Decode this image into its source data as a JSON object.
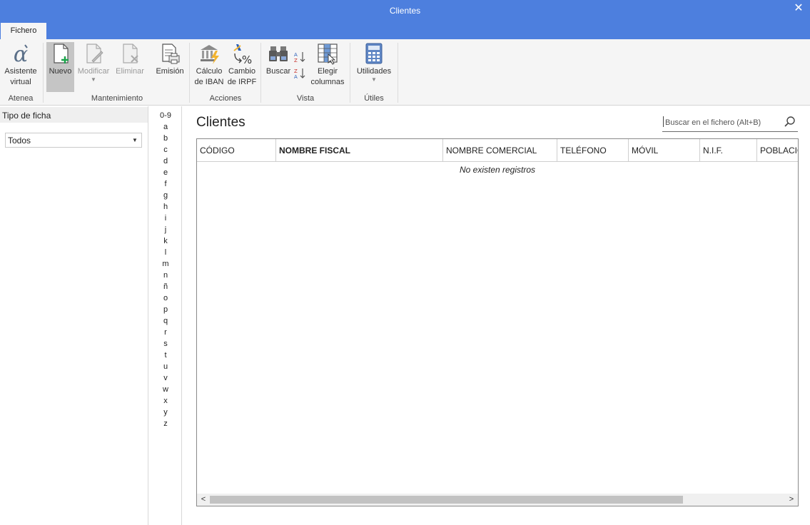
{
  "window": {
    "title": "Clientes"
  },
  "ribbon": {
    "tab": "Fichero",
    "buttons": {
      "asistente": "Asistente virtual",
      "nuevo": "Nuevo",
      "modificar": "Modificar",
      "eliminar": "Eliminar",
      "emision": "Emisión",
      "calculo_iban": "Cálculo de IBAN",
      "cambio_irpf": "Cambio de IRPF",
      "buscar": "Buscar",
      "elegir_columnas": "Elegir columnas",
      "utilidades": "Utilidades"
    },
    "groups": {
      "atenea": "Atenea",
      "mantenimiento": "Mantenimiento",
      "acciones": "Acciones",
      "vista": "Vista",
      "utiles": "Útiles"
    }
  },
  "left_panel": {
    "header": "Tipo de ficha",
    "select_value": "Todos"
  },
  "alphabet": [
    "0-9",
    "a",
    "b",
    "c",
    "d",
    "e",
    "f",
    "g",
    "h",
    "i",
    "j",
    "k",
    "l",
    "m",
    "n",
    "ñ",
    "o",
    "p",
    "q",
    "r",
    "s",
    "t",
    "u",
    "v",
    "w",
    "x",
    "y",
    "z"
  ],
  "main": {
    "heading": "Clientes",
    "search_placeholder": "Buscar en el fichero (Alt+B)",
    "columns": [
      "CÓDIGO",
      "NOMBRE FISCAL",
      "NOMBRE COMERCIAL",
      "TELÉFONO",
      "MÓVIL",
      "N.I.F.",
      "POBLACIÓN"
    ],
    "empty_message": "No existen registros"
  }
}
